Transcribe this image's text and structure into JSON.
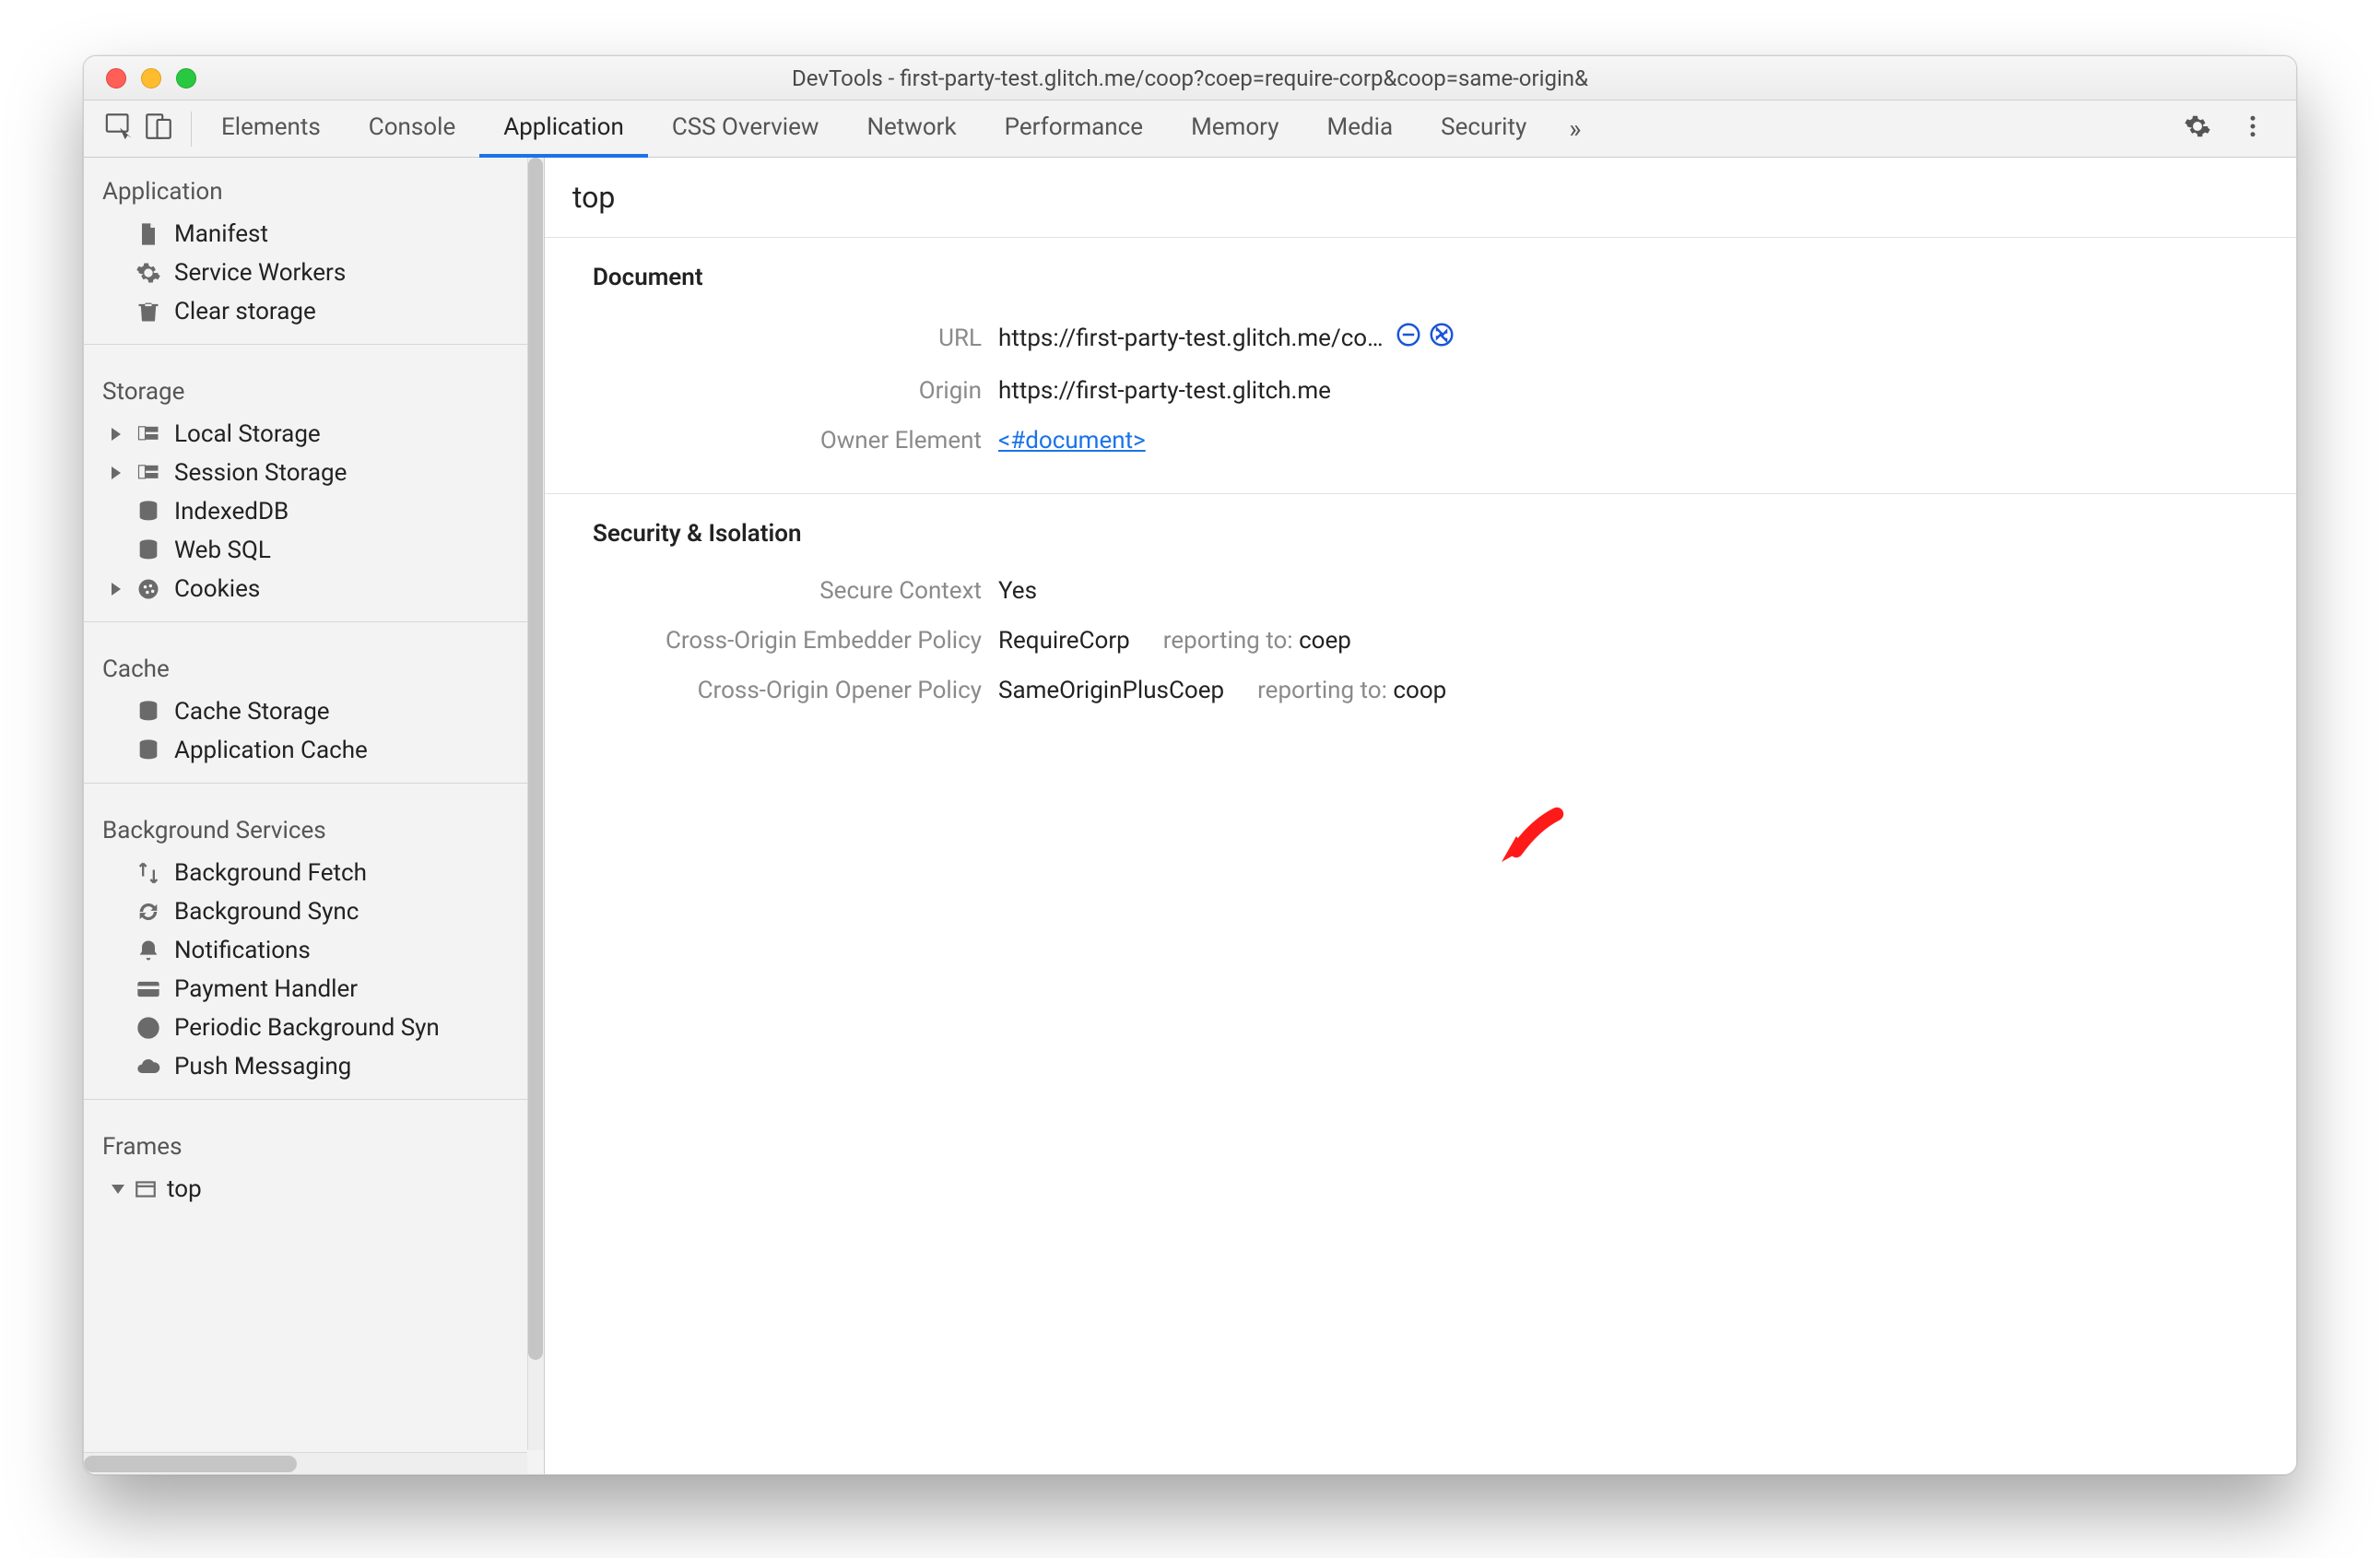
{
  "window_title": "DevTools - first-party-test.glitch.me/coop?coep=require-corp&coop=same-origin&",
  "tabs": {
    "elements": "Elements",
    "console": "Console",
    "application": "Application",
    "css_overview": "CSS Overview",
    "network": "Network",
    "performance": "Performance",
    "memory": "Memory",
    "media": "Media",
    "security": "Security"
  },
  "sidebar": {
    "application": {
      "title": "Application",
      "manifest": "Manifest",
      "service_workers": "Service Workers",
      "clear_storage": "Clear storage"
    },
    "storage": {
      "title": "Storage",
      "local_storage": "Local Storage",
      "session_storage": "Session Storage",
      "indexeddb": "IndexedDB",
      "web_sql": "Web SQL",
      "cookies": "Cookies"
    },
    "cache": {
      "title": "Cache",
      "cache_storage": "Cache Storage",
      "application_cache": "Application Cache"
    },
    "background": {
      "title": "Background Services",
      "background_fetch": "Background Fetch",
      "background_sync": "Background Sync",
      "notifications": "Notifications",
      "payment_handler": "Payment Handler",
      "periodic_sync": "Periodic Background Syn",
      "push_messaging": "Push Messaging"
    },
    "frames": {
      "title": "Frames",
      "top": "top"
    }
  },
  "panel": {
    "header": "top",
    "document": {
      "title": "Document",
      "url_label": "URL",
      "url_value": "https://first-party-test.glitch.me/co…",
      "origin_label": "Origin",
      "origin_value": "https://first-party-test.glitch.me",
      "owner_label": "Owner Element",
      "owner_value": "<#document>"
    },
    "security": {
      "title": "Security & Isolation",
      "secure_context_label": "Secure Context",
      "secure_context_value": "Yes",
      "coep_label": "Cross-Origin Embedder Policy",
      "coep_value": "RequireCorp",
      "coep_reporting_label": "reporting to:",
      "coep_reporting_value": "coep",
      "coop_label": "Cross-Origin Opener Policy",
      "coop_value": "SameOriginPlusCoep",
      "coop_reporting_label": "reporting to:",
      "coop_reporting_value": "coop"
    }
  }
}
